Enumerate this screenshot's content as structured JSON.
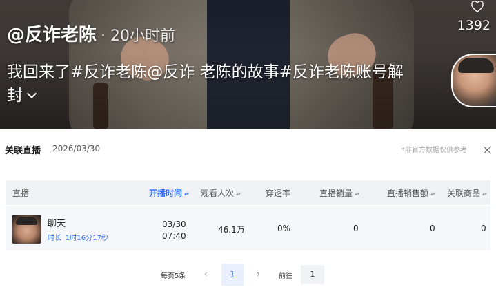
{
  "video": {
    "author": "@反诈老陈",
    "time": "· 20小时前",
    "caption": "我回来了#反诈老陈@反诈 老陈的故事#反诈老陈账号解封",
    "like_count": "1392"
  },
  "panel": {
    "title": "关联直播",
    "date": "2026/03/30",
    "note": "*非官方数据仅供参考",
    "columns": {
      "live": "直播",
      "start_time": "开播时间",
      "viewers": "观看人次",
      "penetration": "穿透率",
      "sales_count": "直播销量",
      "sales_amount": "直播销售额",
      "products": "关联商品"
    },
    "rows": [
      {
        "name": "聊天",
        "duration_label": "时长",
        "duration": "1时16分17秒",
        "date": "03/30",
        "time": "07:40",
        "viewers": "46.1万",
        "penetration": "0%",
        "sales_count": "0",
        "sales_amount": "0",
        "products": "0"
      }
    ],
    "pager": {
      "page_size": "每页5条",
      "prev": "‹",
      "current": "1",
      "next": "›",
      "goto": "前往",
      "goto_value": "1"
    }
  },
  "colors": {
    "accent": "#2f6bff",
    "header_bg": "#f1f2f5",
    "row_bg": "#f6f7fa"
  }
}
